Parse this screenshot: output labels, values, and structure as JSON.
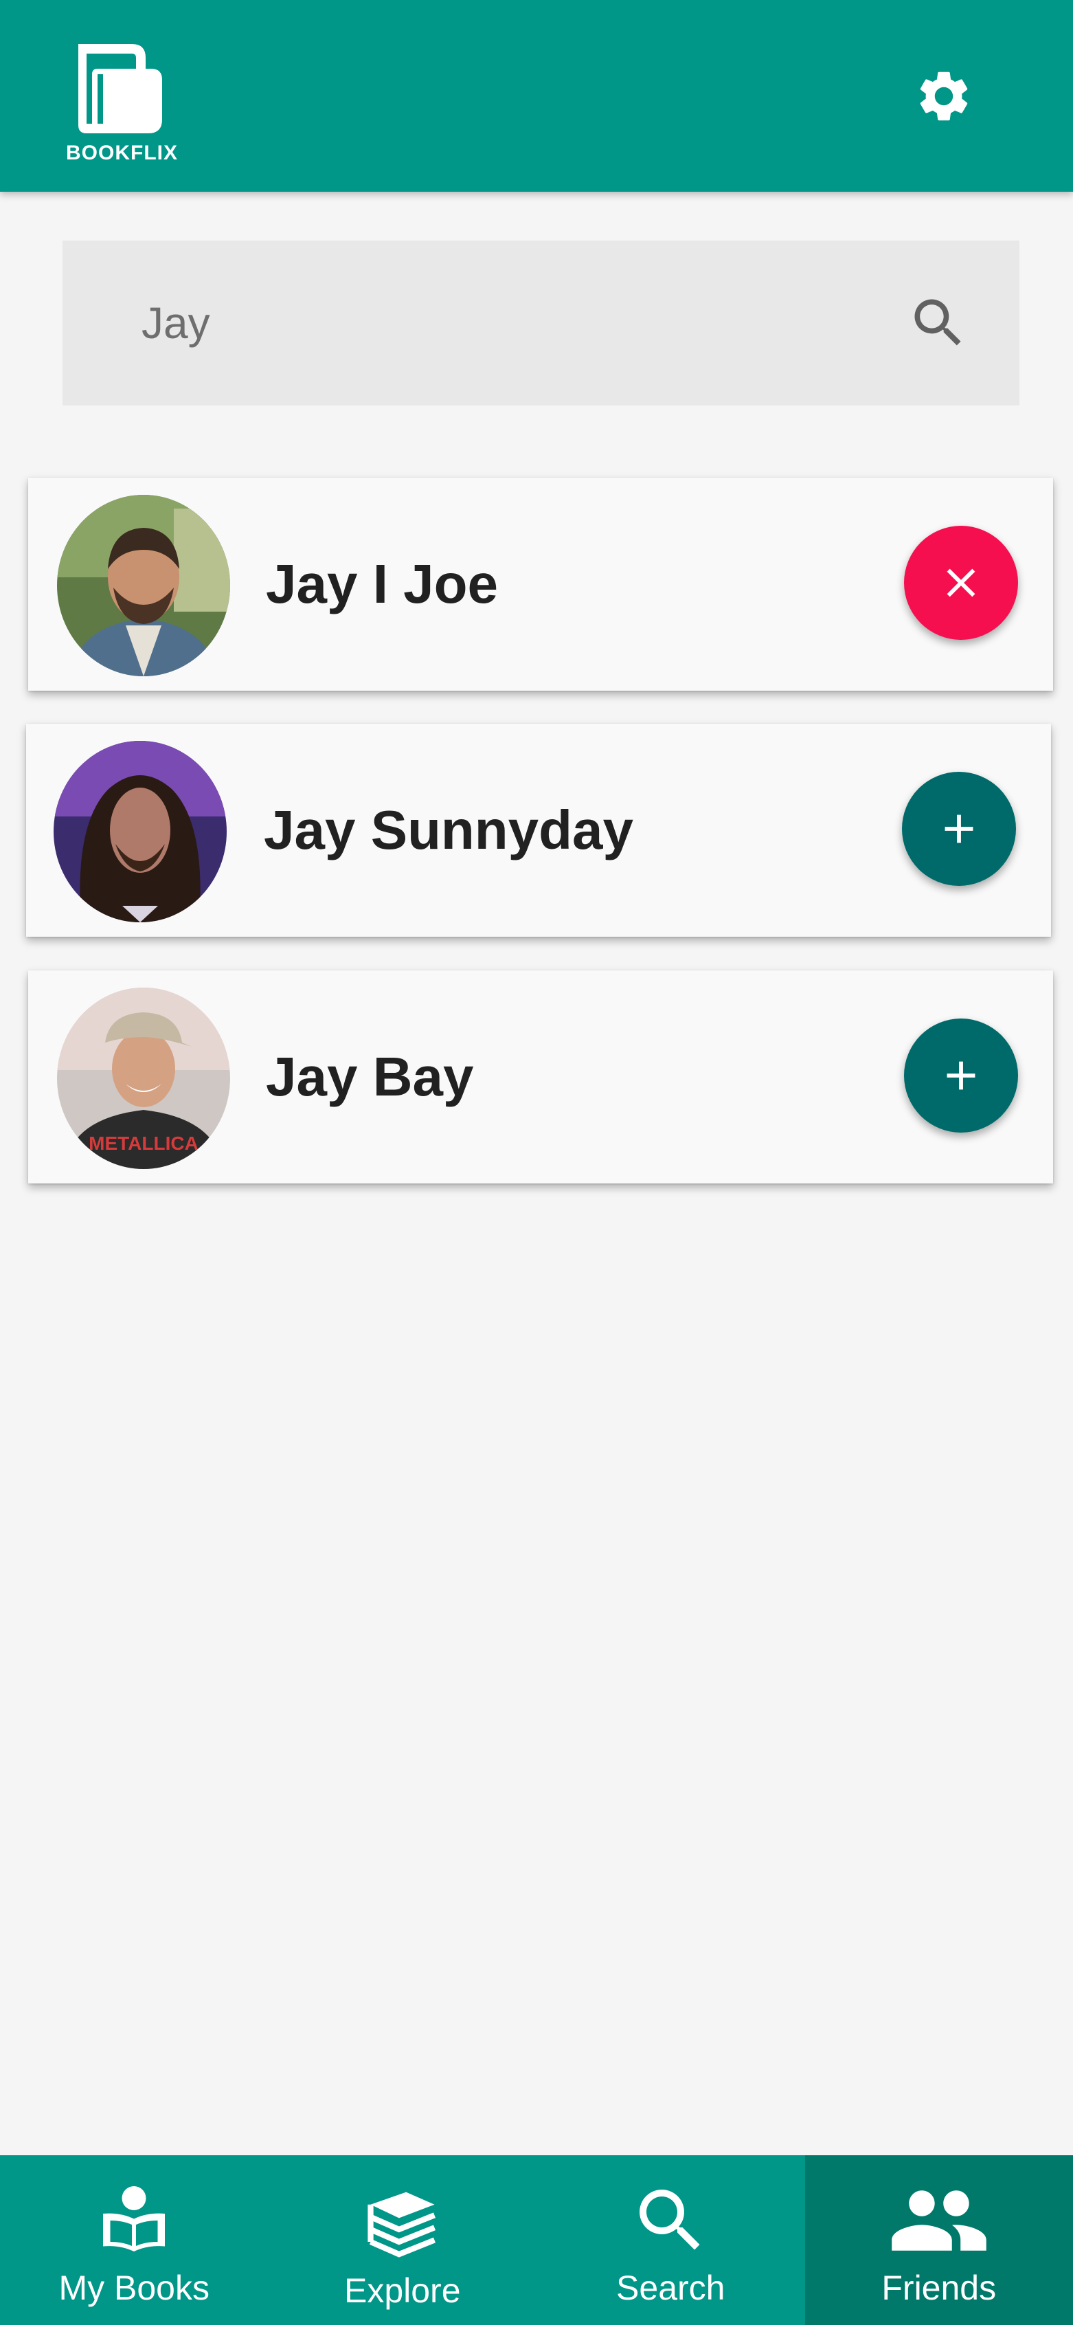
{
  "app": {
    "logo_text": "BOOKFLIX",
    "icons": {
      "settings": "gear-icon"
    }
  },
  "search": {
    "value": "Jay",
    "icon": "search-icon"
  },
  "friends": [
    {
      "name": "Jay I Joe",
      "action": "remove",
      "action_icon": "close-icon"
    },
    {
      "name": "Jay Sunnyday",
      "action": "add",
      "action_icon": "plus-icon"
    },
    {
      "name": "Jay Bay",
      "action": "add",
      "action_icon": "plus-icon"
    }
  ],
  "nav": {
    "items": [
      {
        "label": "My Books",
        "icon": "reader-icon"
      },
      {
        "label": "Explore",
        "icon": "books-stack-icon"
      },
      {
        "label": "Search",
        "icon": "search-icon"
      },
      {
        "label": "Friends",
        "icon": "people-icon"
      }
    ],
    "active": "Friends"
  },
  "colors": {
    "primary": "#009688",
    "primary_dark": "#00796b",
    "remove_button": "#f50f4f",
    "add_button": "#006a6a",
    "background": "#f5f5f5",
    "search_field": "#e8e8e8"
  }
}
